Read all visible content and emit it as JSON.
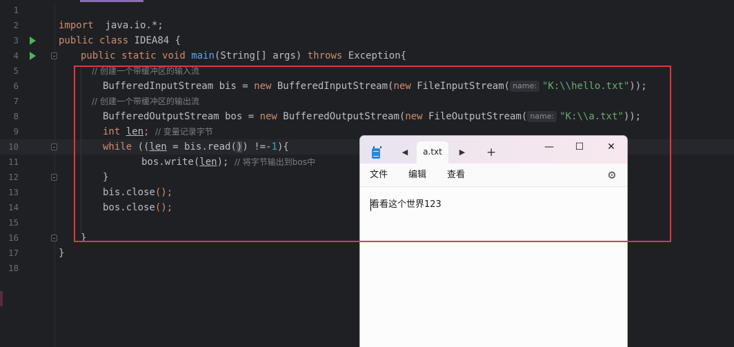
{
  "editor": {
    "lines": [
      "1",
      "2",
      "3",
      "4",
      "5",
      "6",
      "7",
      "8",
      "9",
      "10",
      "11",
      "12",
      "13",
      "14",
      "15",
      "16",
      "17",
      "18"
    ],
    "kw_import": "import",
    "import_path": " java.io.*;",
    "kw_public": "public",
    "kw_class": "class",
    "class_name": "IDEA84 {",
    "kw_static": "static",
    "kw_void": "void",
    "method_name": "main",
    "params": "(String[] args) ",
    "kw_throws": "throws",
    "exception": " Exception{",
    "comment_input": "// 创建一个带缓冲区的输入流",
    "type_bis": "BufferedInputStream bis = ",
    "kw_new": "new",
    "ctor_bis": " BufferedInputStream(",
    "ctor_fis": " FileInputStream(",
    "hint_name": "name:",
    "str_hello": "\"K:\\\\hello.txt\"",
    "close_parens": "));",
    "comment_output": "// 创建一个带缓冲区的输出流",
    "type_bos": "BufferedOutputStream bos = ",
    "ctor_bos": " BufferedOutputStream(",
    "ctor_fos": " FileOutputStream(",
    "str_a": "\"K:\\\\a.txt\"",
    "kw_int": "int",
    "var_len": "len",
    "semicolon": ";",
    "comment_len": "// 变量记录字节",
    "kw_while": "while",
    "while_open": " ((",
    "assign": " = bis.read(",
    "close_paren": ")",
    "while_rest": ") !=-",
    "num_1": "1",
    "while_close": "){",
    "write_call": "bos.write(",
    "write_end": ");",
    "comment_write": "// 将字节输出到bos中",
    "brace_close": "}",
    "bis_close": "bis.close",
    "bos_close": "bos.close",
    "call_end": "();"
  },
  "notepad": {
    "tab_title": "a.txt",
    "new_tab": "+",
    "back": "◀",
    "forward": "▶",
    "minimize": "—",
    "maximize": "☐",
    "close": "✕",
    "menu_file": "文件",
    "menu_edit": "编辑",
    "menu_view": "查看",
    "settings": "⚙",
    "content": "看看这个世界123"
  },
  "colors": {
    "annotation": "#e0383d",
    "editor_bg": "#1f2024",
    "keyword": "#cf8e6d",
    "string": "#6aab73"
  }
}
